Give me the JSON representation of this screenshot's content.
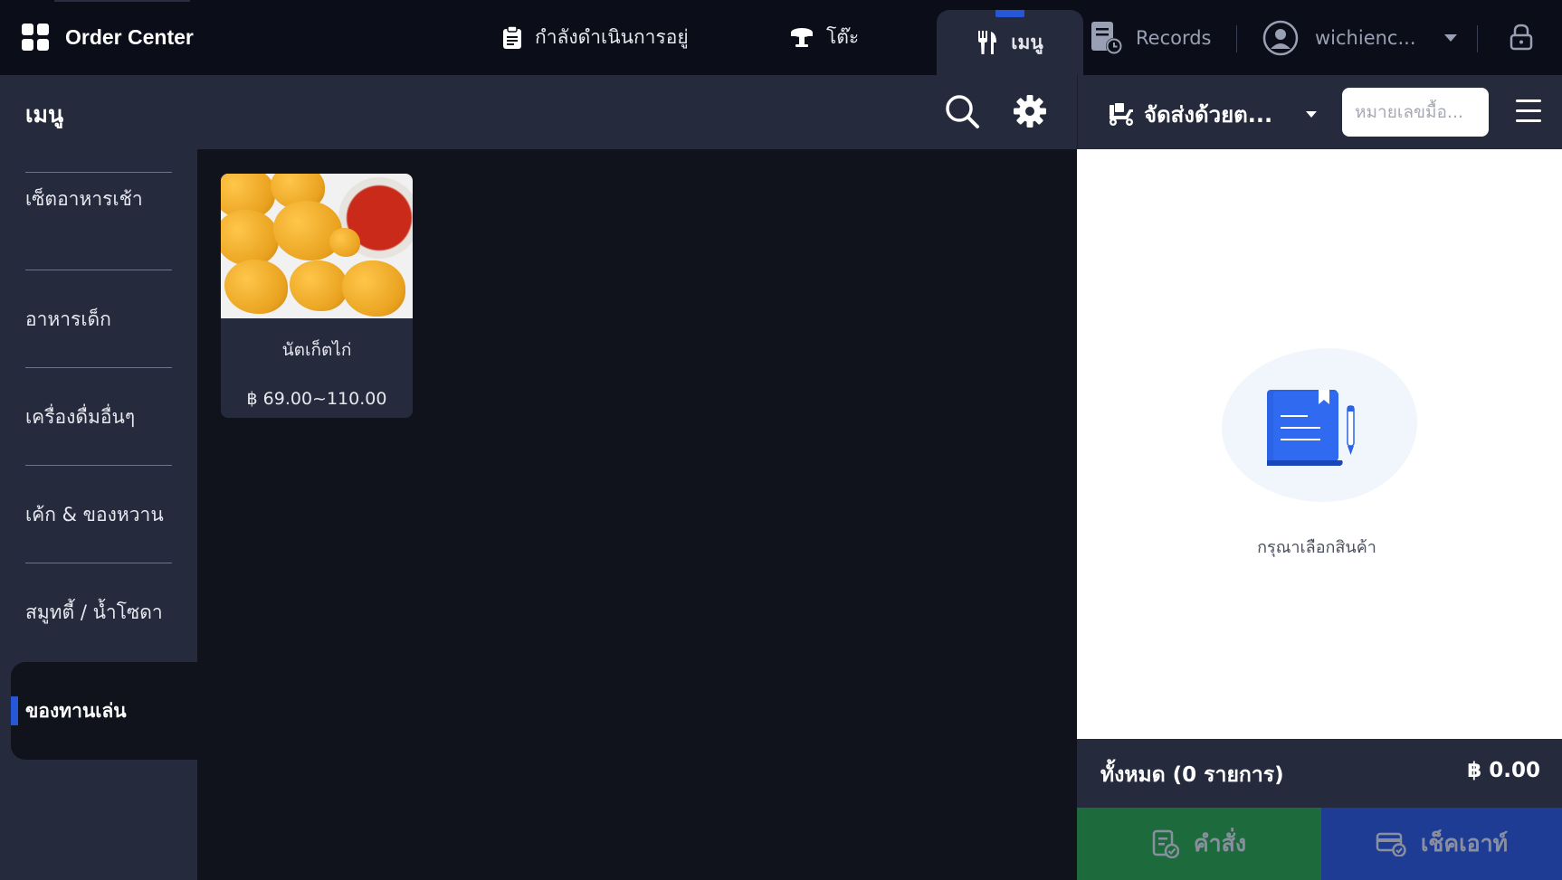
{
  "app": {
    "title": "Order Center"
  },
  "tabs": {
    "in_progress": "กำลังดำเนินการอยู่",
    "tables": "โต๊ะ",
    "menu": "เมนู",
    "records": "Records"
  },
  "user": {
    "name": "wichienc..."
  },
  "menu_header": {
    "label": "เมนู"
  },
  "order_header": {
    "delivery_label": "จัดส่งด้วยต...",
    "order_number_placeholder": "หมายเลขมื้อ..."
  },
  "categories": [
    {
      "label": "เซ็ตอาหารเช้า"
    },
    {
      "label": "อาหารเด็ก"
    },
    {
      "label": "เครื่องดื่มอื่นๆ"
    },
    {
      "label": "เค้ก & ของหวาน"
    },
    {
      "label": "สมูทตี้ / น้ำโซดา"
    },
    {
      "label": "ของทานเล่น"
    }
  ],
  "active_category": "ของทานเล่น",
  "products": [
    {
      "name": "นัตเก็ตไก่",
      "price": "฿ 69.00~110.00"
    }
  ],
  "order": {
    "empty_message": "กรุณาเลือกสินค้า",
    "total_label": "ทั้งหมด (0 รายการ)",
    "total_value": "฿ 0.00"
  },
  "actions": {
    "order": "คำสั่ง",
    "checkout": "เช็คเอาท์"
  },
  "colors": {
    "accent": "#2557d6",
    "order_button": "#1d6b3c",
    "checkout_button": "#1e3c93",
    "panel": "#252a3d",
    "background": "#10121c"
  }
}
